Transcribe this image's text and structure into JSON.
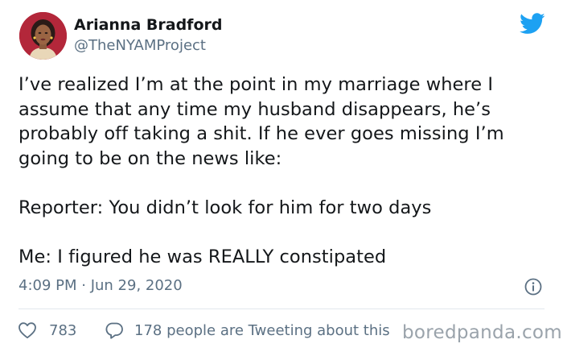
{
  "user": {
    "display_name": "Arianna Bradford",
    "handle": "@TheNYAMProject"
  },
  "tweet": {
    "paragraphs": [
      "I’ve realized I’m at the point in my marriage where I\nassume that any time my husband disappears, he’s\nprobably off taking a shit. If he ever goes missing I’m\ngoing to be on the news like:",
      "Reporter: You didn’t look for him for two days",
      "Me: I figured he was REALLY constipated"
    ],
    "timestamp": "4:09 PM · Jun 29, 2020"
  },
  "actions": {
    "likes": "783",
    "conversation": "178 people are Tweeting about this"
  },
  "watermark": "boredpanda.com",
  "icons": {
    "logo": "twitter-bird-icon",
    "info": "info-icon",
    "like": "heart-icon",
    "reply": "comment-bubble-icon"
  },
  "colors": {
    "twitter_blue": "#1da1f2",
    "secondary_text": "#5b7083",
    "primary_text": "#14171a"
  }
}
